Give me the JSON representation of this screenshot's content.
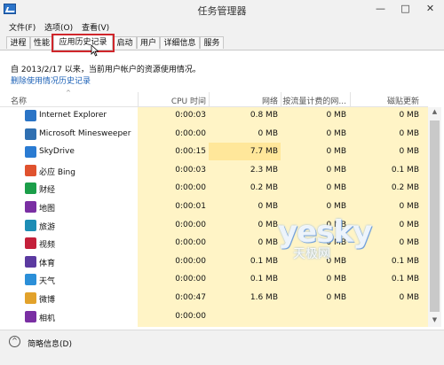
{
  "window": {
    "title": "任务管理器",
    "min": "—",
    "max": "□",
    "close": "✕"
  },
  "menu": [
    "文件(F)",
    "选项(O)",
    "查看(V)"
  ],
  "tabs": [
    "进程",
    "性能",
    "应用历史记录",
    "启动",
    "用户",
    "详细信息",
    "服务"
  ],
  "active_tab_index": 2,
  "info_text": "自 2013/2/17 以来，当前用户帐户的资源使用情况。",
  "delete_link": "删除使用情况历史记录",
  "columns": {
    "name": "名称",
    "cpu": "CPU 时间",
    "network": "网络",
    "metered": "按流量计费的网...",
    "tile": "磁贴更新"
  },
  "rows": [
    {
      "name": "Internet Explorer",
      "icon": "internet-explorer-icon",
      "color": "#2a74c6",
      "cpu": "0:00:03",
      "net": "0.8 MB",
      "metered": "0 MB",
      "tile": "0 MB"
    },
    {
      "name": "Microsoft Minesweeper",
      "icon": "minesweeper-icon",
      "color": "#2f6fb1",
      "cpu": "0:00:00",
      "net": "0 MB",
      "metered": "0 MB",
      "tile": "0 MB"
    },
    {
      "name": "SkyDrive",
      "icon": "skydrive-icon",
      "color": "#2a7bd2",
      "cpu": "0:00:15",
      "net": "7.7 MB",
      "metered": "0 MB",
      "tile": "0 MB"
    },
    {
      "name": "必应 Bing",
      "icon": "bing-icon",
      "color": "#e0522e",
      "cpu": "0:00:03",
      "net": "2.3 MB",
      "metered": "0 MB",
      "tile": "0.1 MB"
    },
    {
      "name": "财经",
      "icon": "finance-icon",
      "color": "#1b9e49",
      "cpu": "0:00:00",
      "net": "0.2 MB",
      "metered": "0 MB",
      "tile": "0.2 MB"
    },
    {
      "name": "地图",
      "icon": "maps-icon",
      "color": "#7a2fa3",
      "cpu": "0:00:01",
      "net": "0 MB",
      "metered": "0 MB",
      "tile": "0 MB"
    },
    {
      "name": "旅游",
      "icon": "travel-icon",
      "color": "#1d8db5",
      "cpu": "0:00:00",
      "net": "0 MB",
      "metered": "0 MB",
      "tile": "0 MB"
    },
    {
      "name": "视频",
      "icon": "video-icon",
      "color": "#c4203a",
      "cpu": "0:00:00",
      "net": "0 MB",
      "metered": "0 MB",
      "tile": "0 MB"
    },
    {
      "name": "体育",
      "icon": "sports-icon",
      "color": "#5b3aa0",
      "cpu": "0:00:00",
      "net": "0.1 MB",
      "metered": "0 MB",
      "tile": "0.1 MB"
    },
    {
      "name": "天气",
      "icon": "weather-icon",
      "color": "#2b8fd8",
      "cpu": "0:00:00",
      "net": "0.1 MB",
      "metered": "0 MB",
      "tile": "0.1 MB"
    },
    {
      "name": "微博",
      "icon": "weibo-icon",
      "color": "#e2a22b",
      "cpu": "0:00:47",
      "net": "1.6 MB",
      "metered": "0 MB",
      "tile": "0 MB"
    },
    {
      "name": "相机",
      "icon": "camera-icon",
      "color": "#7a2fa3",
      "cpu": "0:00:00",
      "net": "",
      "metered": "",
      "tile": ""
    }
  ],
  "footer": {
    "fewer_details": "简略信息(D)"
  },
  "watermark": {
    "main": "yesky",
    "sub": "天极网"
  }
}
